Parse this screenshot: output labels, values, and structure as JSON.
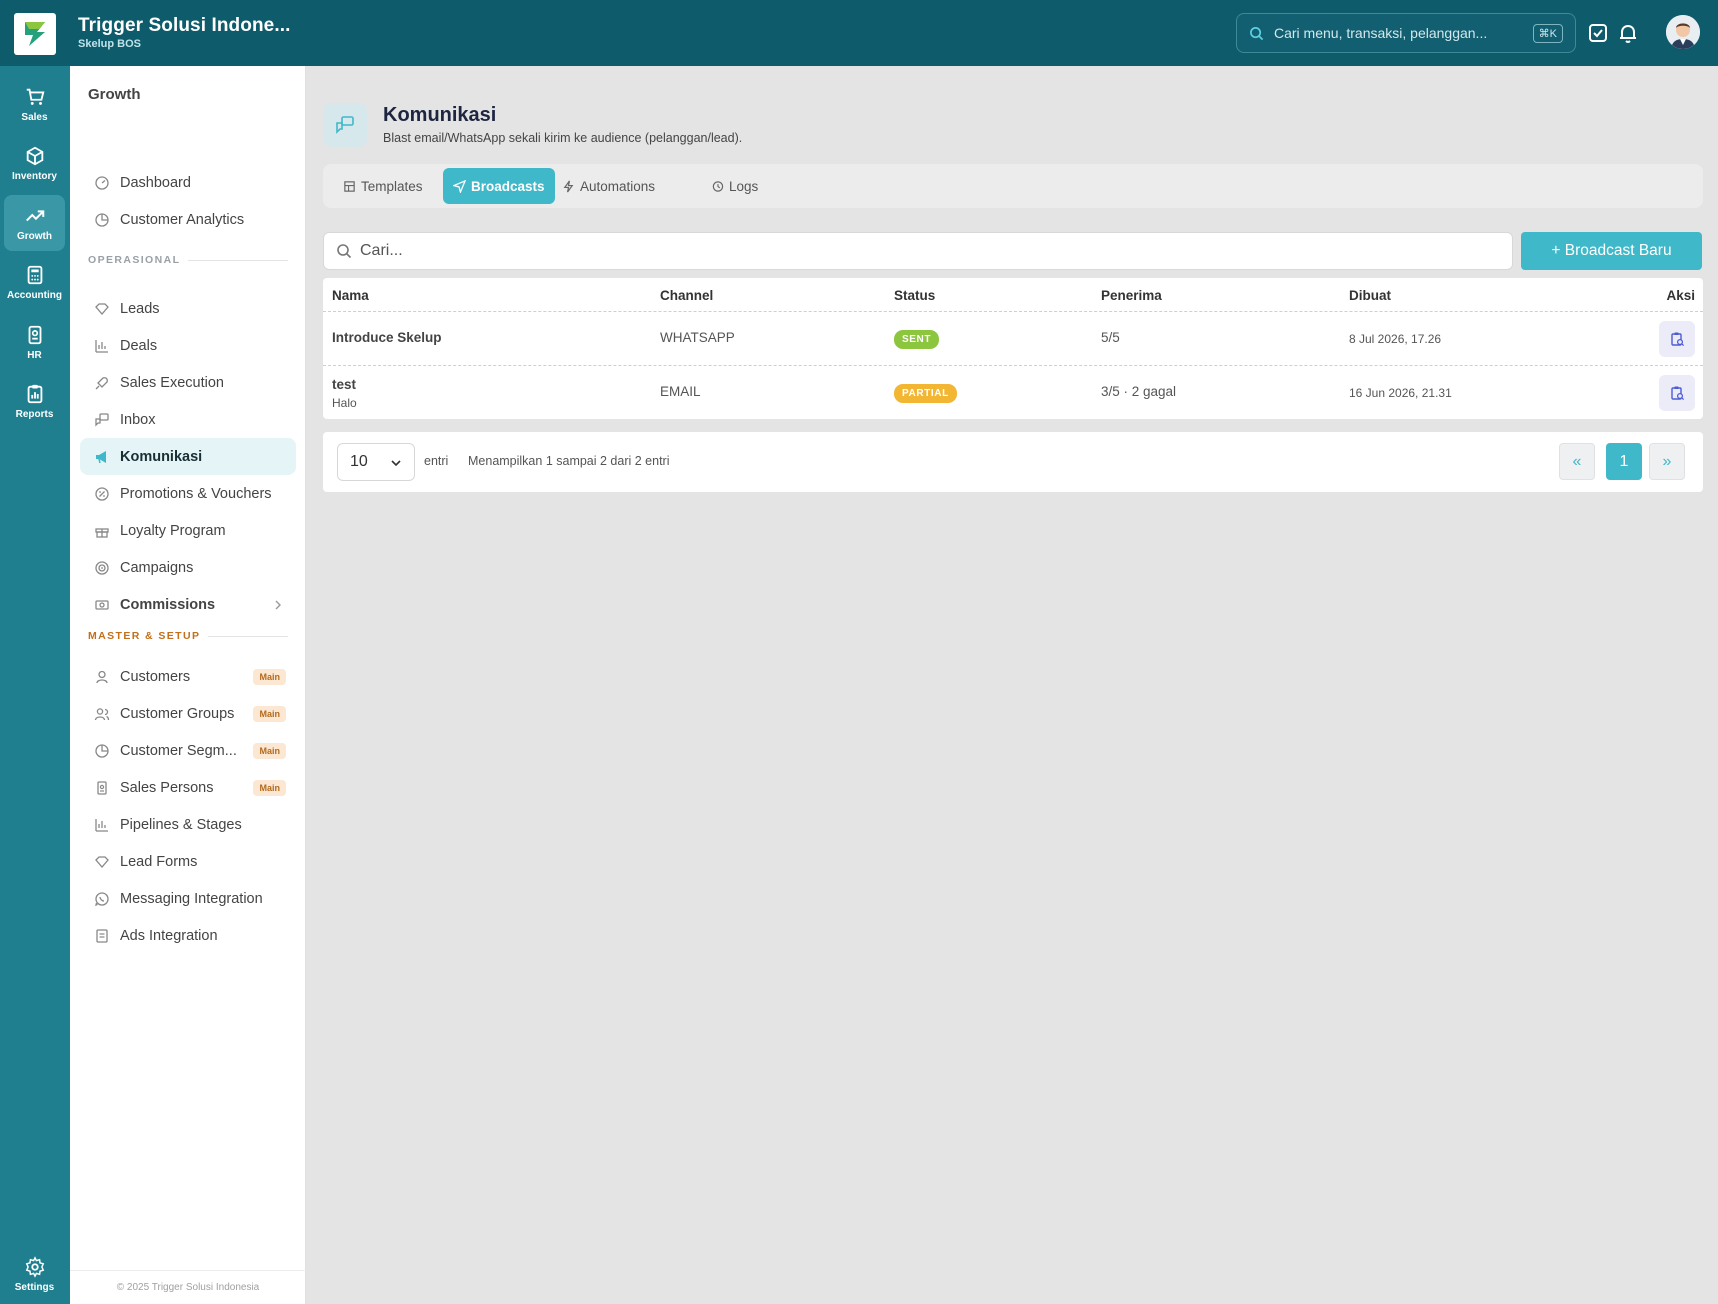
{
  "header": {
    "company_name": "Trigger Solusi Indone...",
    "company_sub": "Skelup BOS",
    "search_placeholder": "Cari menu, transaksi, pelanggan...",
    "search_shortcut": "⌘K"
  },
  "rail": {
    "items": [
      {
        "label": "Sales",
        "icon": "cart-icon"
      },
      {
        "label": "Inventory",
        "icon": "box-icon"
      },
      {
        "label": "Growth",
        "icon": "trend-up-icon",
        "active": true
      },
      {
        "label": "Accounting",
        "icon": "calculator-icon"
      },
      {
        "label": "HR",
        "icon": "id-badge-icon"
      },
      {
        "label": "Reports",
        "icon": "clipboard-chart-icon"
      }
    ],
    "settings_label": "Settings"
  },
  "sidebar": {
    "title": "Growth",
    "top_items": [
      {
        "label": "Dashboard"
      },
      {
        "label": "Customer Analytics"
      }
    ],
    "section_ops": "OPERASIONAL",
    "ops_items": [
      {
        "label": "Leads"
      },
      {
        "label": "Deals"
      },
      {
        "label": "Sales Execution"
      },
      {
        "label": "Inbox"
      },
      {
        "label": "Komunikasi",
        "active": true
      },
      {
        "label": "Promotions & Vouchers"
      },
      {
        "label": "Loyalty Program"
      },
      {
        "label": "Campaigns"
      },
      {
        "label": "Commissions"
      }
    ],
    "section_master": "MASTER & SETUP",
    "master_items": [
      {
        "label": "Customers",
        "badge": "Main"
      },
      {
        "label": "Customer Groups",
        "badge": "Main"
      },
      {
        "label": "Customer Segm...",
        "badge": "Main"
      },
      {
        "label": "Sales Persons",
        "badge": "Main"
      },
      {
        "label": "Pipelines & Stages"
      },
      {
        "label": "Lead Forms"
      },
      {
        "label": "Messaging Integration"
      },
      {
        "label": "Ads Integration"
      }
    ],
    "footer": "© 2025 Trigger Solusi Indonesia"
  },
  "page": {
    "title": "Komunikasi",
    "subtitle": "Blast email/WhatsApp sekali kirim ke audience (pelanggan/lead).",
    "tabs": [
      {
        "label": "Templates"
      },
      {
        "label": "Broadcasts",
        "active": true
      },
      {
        "label": "Automations"
      },
      {
        "label": "Logs"
      }
    ],
    "search_placeholder": "Cari...",
    "new_button": "+ Broadcast Baru"
  },
  "table": {
    "columns": [
      "Nama",
      "Channel",
      "Status",
      "Penerima",
      "Dibuat",
      "Aksi"
    ],
    "rows": [
      {
        "name": "Introduce Skelup",
        "subtitle": "",
        "channel": "WHATSAPP",
        "status": "SENT",
        "status_color": "#8cc63f",
        "recipients": "5/5",
        "created": "8 Jul 2026, 17.26"
      },
      {
        "name": "test",
        "subtitle": "Halo",
        "channel": "EMAIL",
        "status": "PARTIAL",
        "status_color": "#f2b632",
        "recipients": "3/5 · 2 gagal",
        "created": "16 Jun 2026, 21.31"
      }
    ]
  },
  "pager": {
    "page_size": "10",
    "entries_label": "entri",
    "summary": "Menampilkan 1 sampai 2 dari 2 entri",
    "prev": "«",
    "current": "1",
    "next": "»"
  },
  "colors": {
    "header_bg": "#0e5b6b",
    "rail_bg": "#1f7f8f",
    "accent": "#3fb8c9",
    "section_orange": "#c36f1c"
  }
}
